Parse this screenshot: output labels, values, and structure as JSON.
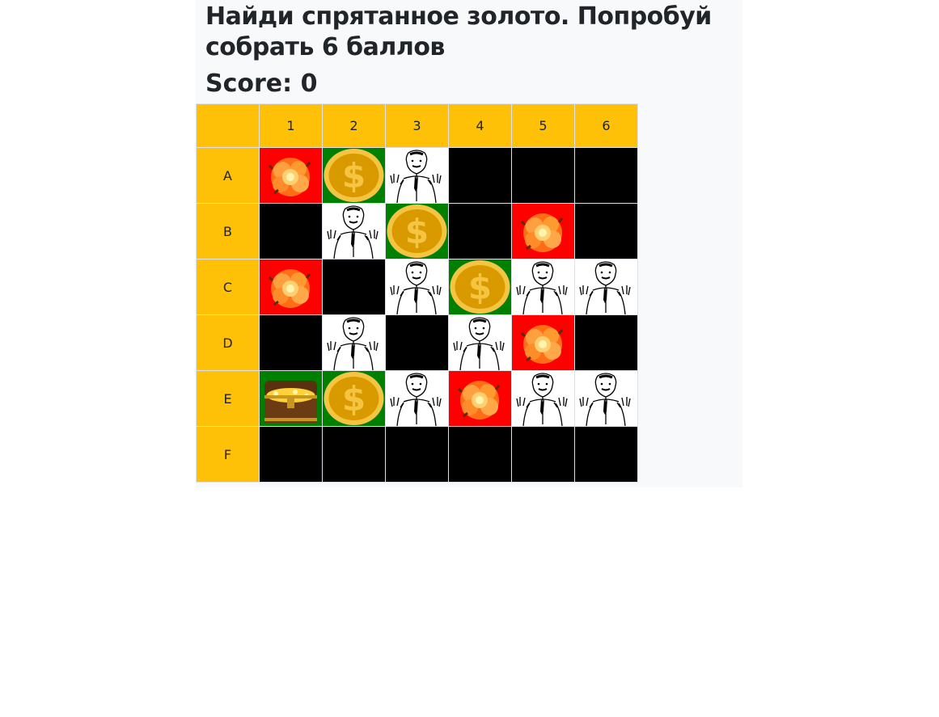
{
  "title": "Найди спрятанное золото. Попробуй собрать 6 баллов",
  "score": {
    "label": "Score:",
    "value": "0"
  },
  "columns": [
    "1",
    "2",
    "3",
    "4",
    "5",
    "6"
  ],
  "rows": [
    {
      "label": "A",
      "cells": [
        "bomb",
        "coin",
        "man",
        "hidden",
        "hidden",
        "hidden"
      ]
    },
    {
      "label": "B",
      "cells": [
        "hidden",
        "man",
        "coin",
        "hidden",
        "bomb",
        "hidden"
      ]
    },
    {
      "label": "C",
      "cells": [
        "bomb",
        "hidden",
        "man",
        "coin",
        "man",
        "man"
      ]
    },
    {
      "label": "D",
      "cells": [
        "hidden",
        "man",
        "hidden",
        "man",
        "bomb",
        "hidden"
      ]
    },
    {
      "label": "E",
      "cells": [
        "chest",
        "coin",
        "man",
        "bomb",
        "man",
        "man"
      ]
    },
    {
      "label": "F",
      "cells": [
        "hidden",
        "hidden",
        "hidden",
        "hidden",
        "hidden",
        "hidden"
      ]
    }
  ],
  "colors": {
    "header": "#ffc107",
    "hidden": "#000000",
    "bomb_bg": "#ff0000",
    "coin_bg": "#008000",
    "man_bg": "#ffffff",
    "chest_bg": "#008000"
  },
  "icons": {
    "bomb": "explosion-icon",
    "coin": "dollar-coin-icon",
    "man": "man-raising-hands-icon",
    "chest": "treasure-chest-icon"
  }
}
